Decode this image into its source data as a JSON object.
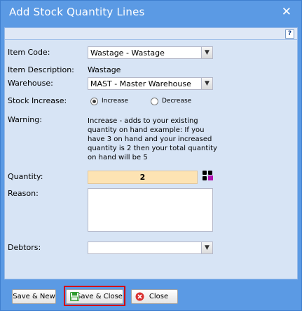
{
  "dialog": {
    "title": "Add Stock Quantity Lines",
    "close_glyph": "✕"
  },
  "help": {
    "glyph": "?"
  },
  "form": {
    "item_code": {
      "label": "Item Code:",
      "value": "Wastage - Wastage"
    },
    "item_description": {
      "label": "Item Description:",
      "value": "Wastage"
    },
    "warehouse": {
      "label": "Warehouse:",
      "value": "MAST - Master Warehouse"
    },
    "stock_increase": {
      "label": "Stock Increase:",
      "options": [
        "Increase",
        "Decrease"
      ],
      "selected": "Increase"
    },
    "warning": {
      "label": "Warning:",
      "text": "Increase - adds to your existing quantity on hand example: If you have 3 on hand and your increased quantity is 2 then your total quantity on hand will be 5"
    },
    "quantity": {
      "label": "Quantity:",
      "value": "2"
    },
    "reason": {
      "label": "Reason:",
      "value": ""
    },
    "debtors": {
      "label": "Debtors:",
      "value": ""
    }
  },
  "buttons": {
    "save_new": "Save & New",
    "save_close": "Save & Close",
    "close": "Close"
  },
  "colors": {
    "title_bar": "#5b9ae4",
    "panel": "#d7e4f5",
    "quantity_bg": "#fde3b3",
    "highlight": "#d40000"
  }
}
